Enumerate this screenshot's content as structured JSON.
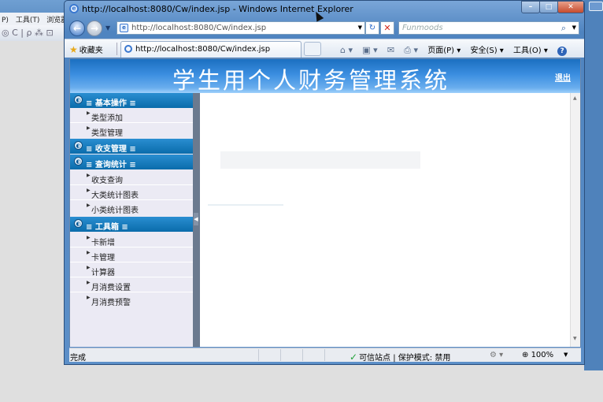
{
  "background_window": {
    "menu": [
      "P)",
      "工具(T)",
      "浏览器"
    ],
    "toolbar_icons": "◎ C | ρ ⁂ ⊡"
  },
  "window": {
    "title": "http://localhost:8080/Cw/index.jsp - Windows Internet Explorer",
    "controls": {
      "minimize": "–",
      "maximize": "□",
      "close": "✕"
    }
  },
  "address_bar": {
    "url": "http://localhost:8080/Cw/index.jsp",
    "search_placeholder": "Funmoods"
  },
  "favorites_bar": {
    "favorites_label": "收藏夹",
    "tab_title": "http://localhost:8080/Cw/index.jsp",
    "commands": {
      "page": "页面(P) ▾",
      "safety": "安全(S) ▾",
      "tools": "工具(O) ▾"
    }
  },
  "page": {
    "system_title": "学生用个人财务管理系统",
    "logout": "退出"
  },
  "sidebar": {
    "sections": [
      {
        "label": "≡ 基本操作 ≡",
        "items": [
          "类型添加",
          "类型管理"
        ]
      },
      {
        "label": "≡ 收支管理 ≡",
        "items": []
      },
      {
        "label": "≡ 查询统计 ≡",
        "items": [
          "收支查询",
          "大类统计图表",
          "小类统计图表"
        ]
      },
      {
        "label": "≡ 工具箱 ≡",
        "items": [
          "卡新增",
          "卡管理",
          "计算器",
          "月消费设置",
          "月消费预警"
        ]
      }
    ]
  },
  "status_bar": {
    "status": "完成",
    "zone": "可信站点 | 保护模式: 禁用",
    "zoom": "100%"
  }
}
